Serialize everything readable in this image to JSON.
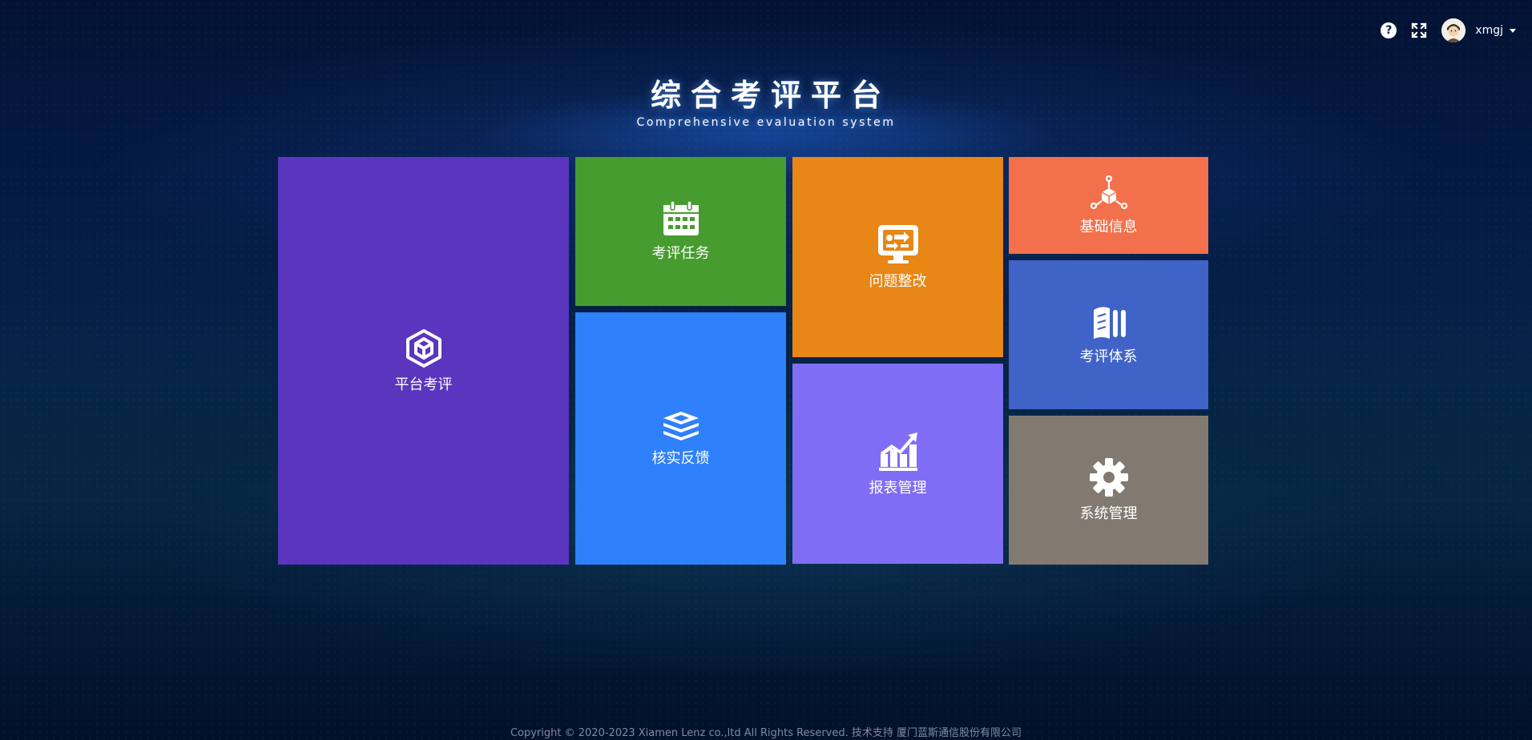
{
  "header": {
    "title_zh": "综合考评平台",
    "title_en": "Comprehensive evaluation system"
  },
  "topbar": {
    "help_icon": "question-circle-icon",
    "fullscreen_icon": "fullscreen-expand-icon",
    "username": "xmgj",
    "avatar": "user-avatar-image"
  },
  "tiles": {
    "platform_eval": {
      "label": "平台考评",
      "icon": "cube-icon",
      "color": "#5a35be"
    },
    "eval_task": {
      "label": "考评任务",
      "icon": "calendar-icon",
      "color": "#469c2e"
    },
    "verify_feedback": {
      "label": "核实反馈",
      "icon": "stack-layers-icon",
      "color": "#2f80fb"
    },
    "issue_rectify": {
      "label": "问题整改",
      "icon": "monitor-arrows-icon",
      "color": "#e88616"
    },
    "report_mgmt": {
      "label": "报表管理",
      "icon": "chart-growth-icon",
      "color": "#7f6ef5"
    },
    "basic_info": {
      "label": "基础信息",
      "icon": "network-cube-icon",
      "color": "#f2704b"
    },
    "eval_system": {
      "label": "考评体系",
      "icon": "book-columns-icon",
      "color": "#4063c8"
    },
    "system_mgmt": {
      "label": "系统管理",
      "icon": "gear-icon",
      "color": "#827a70"
    }
  },
  "footer": {
    "copyright": "Copyright © 2020-2023 Xiamen Lenz co.,ltd All Rights Reserved. 技术支持 厦门蓝斯通信股份有限公司"
  }
}
